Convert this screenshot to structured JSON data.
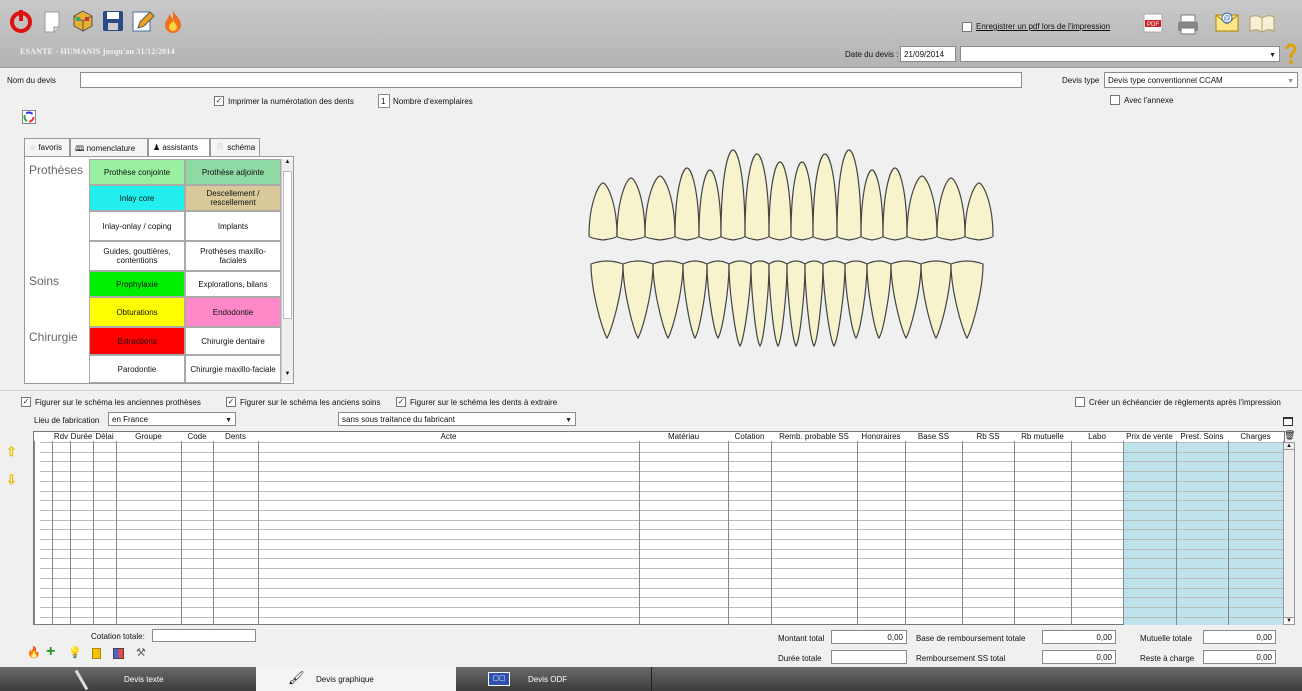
{
  "toolbar": {
    "license": "ESANTE - HUMANIS jusqu'au 31/12/2014",
    "pdf_option_label": "Enregistrer un pdf lors de l'impression",
    "pdf_badge": "PDF",
    "icons": [
      "power-icon",
      "new-document-icon",
      "cube-icon",
      "save-icon",
      "edit-icon",
      "flame-icon",
      "pdf-icon",
      "printer-icon",
      "email-icon",
      "book-icon",
      "help-icon"
    ]
  },
  "header": {
    "date_label": "Date du devis :",
    "date_value": "21/09/2014",
    "nom_label": "Nom du devis",
    "nom_value": "",
    "devis_type_label": "Devis type",
    "devis_type_value": "Devis type conventionnel CCAM",
    "avec_annexe_label": "Avec l'annexe",
    "imprimer_label": "Imprimer la numérotation des dents",
    "exemplaires_value": "1",
    "exemplaires_label": "Nombre d'exemplaires"
  },
  "tabs": [
    {
      "label": "favoris",
      "icon": "star-icon"
    },
    {
      "label": "nomenclature",
      "icon": "book-icon"
    },
    {
      "label": "assistants",
      "icon": "wizard-icon"
    },
    {
      "label": "schéma",
      "icon": "tooth-icon"
    }
  ],
  "categories": {
    "protheses": "Prothèses",
    "soins": "Soins",
    "chirurgie": "Chirurgie"
  },
  "assistants": [
    {
      "label": "Prothèse conjointe",
      "color": "#99f0a0"
    },
    {
      "label": "Prothèse adjointe",
      "color": "#8ed9a4"
    },
    {
      "label": "Inlay core",
      "color": "#22eeee"
    },
    {
      "label": "Descellement / rescellement",
      "color": "#d9c89a"
    },
    {
      "label": "Inlay-onlay / coping",
      "color": "#ffffff"
    },
    {
      "label": "Implants",
      "color": "#ffffff"
    },
    {
      "label": "Guides, gouttières, contentions",
      "color": "#ffffff"
    },
    {
      "label": "Prothèses maxillo-faciales",
      "color": "#ffffff"
    },
    {
      "label": "Prophylaxie",
      "color": "#00ee00"
    },
    {
      "label": "Explorations, bilans",
      "color": "#ffffff"
    },
    {
      "label": "Obturations",
      "color": "#ffff00"
    },
    {
      "label": "Endodontie",
      "color": "#ff88c8"
    },
    {
      "label": "Extractions",
      "color": "#ff0000"
    },
    {
      "label": "Chirurgie dentaire",
      "color": "#ffffff"
    },
    {
      "label": "Parodontie",
      "color": "#ffffff"
    },
    {
      "label": "Chirurgie maxillo-faciale",
      "color": "#ffffff"
    }
  ],
  "options": {
    "anciennes_protheses": "Figurer sur le schéma les anciennes prothèses",
    "anciens_soins": "Figurer sur le schéma les anciens soins",
    "dents_extraire": "Figurer sur le schéma les dents à extraire",
    "echeancier": "Créer un échéancier de règlements après l'impression",
    "lieu_label": "Lieu de fabrication",
    "lieu_value": "en France",
    "soustraitance_value": "sans sous traitance du fabricant"
  },
  "grid_columns": [
    "Rdv",
    "Durée",
    "Délai",
    "Groupe",
    "Code",
    "Dents",
    "Acte",
    "Matériau",
    "Cotation",
    "Remb. probable SS",
    "Honoraires",
    "Base SS",
    "Rb SS",
    "Rb mutuelle",
    "Labo",
    "Prix de vente",
    "Prest. Soins",
    "Charges"
  ],
  "totals": {
    "cotation_label": "Cotation totale:",
    "cotation_value": "",
    "montant_label": "Montant total",
    "montant_value": "0,00",
    "duree_label": "Durée totale",
    "duree_value": "",
    "base_label": "Base de remboursement totale",
    "base_value": "0,00",
    "remb_label": "Remboursement SS total",
    "remb_value": "0,00",
    "mutuelle_label": "Mutuelle totale",
    "mutuelle_value": "0,00",
    "reste_label": "Reste à charge",
    "reste_value": "0,00"
  },
  "bottom_tabs": [
    {
      "label": "Devis texte",
      "active": false
    },
    {
      "label": "Devis graphique",
      "active": true
    },
    {
      "label": "Devis ODF",
      "active": false
    }
  ]
}
